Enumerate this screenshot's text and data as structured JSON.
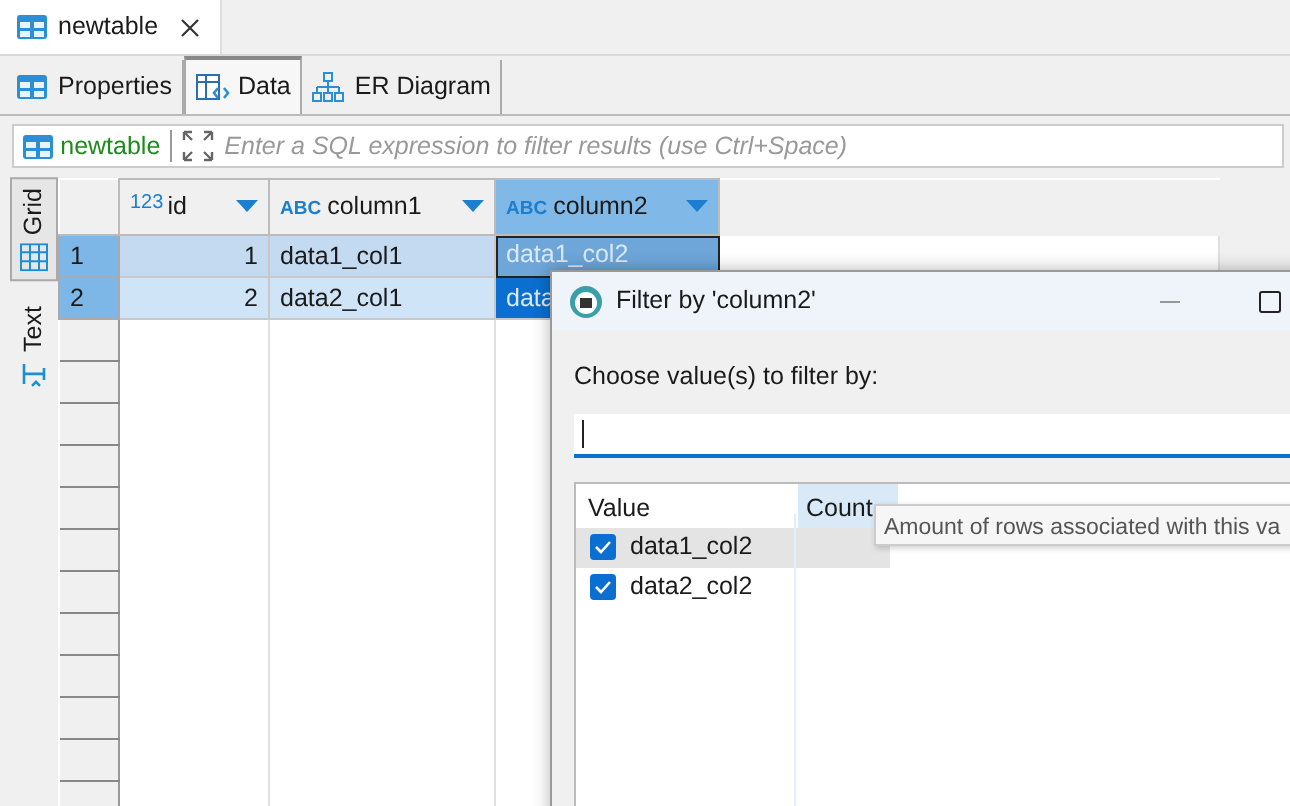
{
  "editor_tab": {
    "title": "newtable"
  },
  "view_tabs": [
    {
      "label": "Properties",
      "kind": "properties",
      "selected": false
    },
    {
      "label": "Data",
      "kind": "data",
      "selected": true
    },
    {
      "label": "ER Diagram",
      "kind": "diagram",
      "selected": false
    }
  ],
  "filter_bar": {
    "table": "newtable",
    "placeholder": "Enter a SQL expression to filter results (use Ctrl+Space)"
  },
  "side_tabs": [
    {
      "label": "Grid",
      "kind": "grid",
      "selected": true
    },
    {
      "label": "Text",
      "kind": "text",
      "selected": false
    }
  ],
  "grid": {
    "columns": [
      {
        "type_label": "123",
        "name": "id",
        "kind": "number",
        "selected": false
      },
      {
        "type_label": "ABC",
        "name": "column1",
        "kind": "string",
        "selected": false
      },
      {
        "type_label": "ABC",
        "name": "column2",
        "kind": "string",
        "selected": true
      }
    ],
    "rows": [
      {
        "row_number": "1",
        "cells": [
          {
            "text": "1",
            "selected": false,
            "focused": false
          },
          {
            "text": "data1_col1",
            "selected": false,
            "focused": false
          },
          {
            "text": "data1_col2",
            "selected": true,
            "focused": true
          }
        ]
      },
      {
        "row_number": "2",
        "cells": [
          {
            "text": "2",
            "selected": false,
            "focused": false
          },
          {
            "text": "data2_col1",
            "selected": false,
            "focused": false
          },
          {
            "text": "data",
            "selected": true,
            "focused": false
          }
        ]
      }
    ]
  },
  "dialog": {
    "title": "Filter by 'column2'",
    "prompt": "Choose value(s) to filter by:",
    "columns": [
      {
        "label": "Value",
        "hovered": false
      },
      {
        "label": "Count",
        "hovered": true
      }
    ],
    "items": [
      {
        "label": "data1_col2",
        "checked": true,
        "selected": true
      },
      {
        "label": "data2_col2",
        "checked": true,
        "selected": false
      }
    ],
    "tooltip": "Amount of rows associated with this va"
  }
}
